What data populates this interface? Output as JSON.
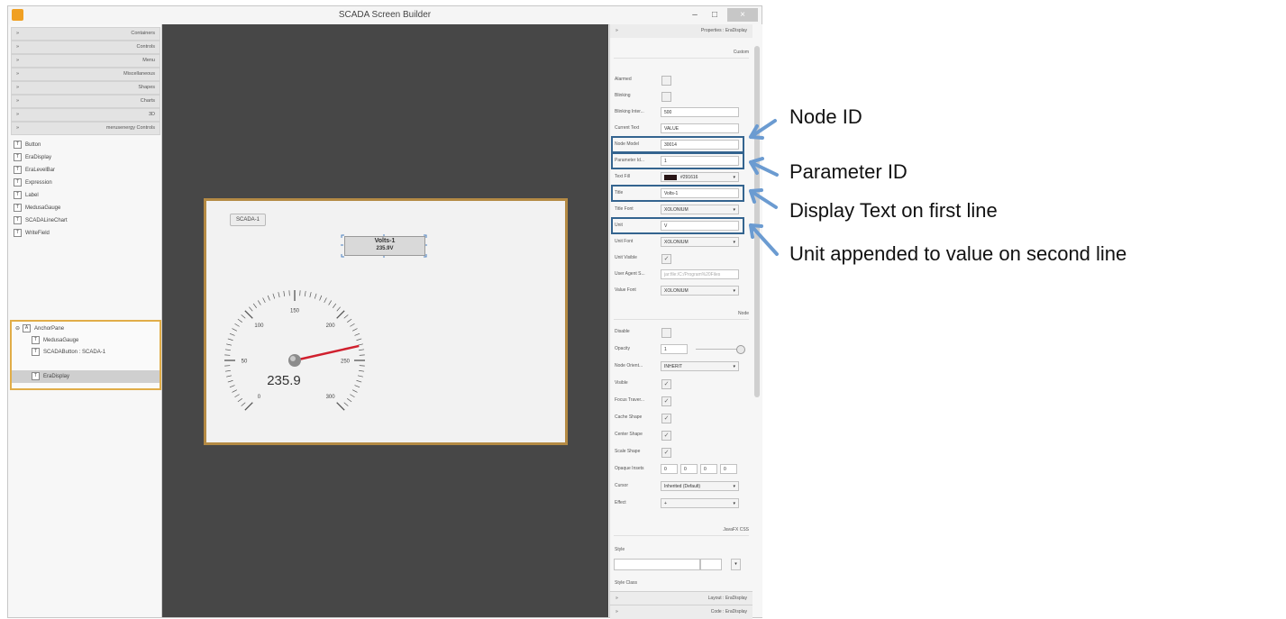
{
  "window": {
    "title": "SCADA Screen Builder",
    "controls": [
      "–",
      "□",
      "×"
    ]
  },
  "library": {
    "sections": [
      {
        "chevron": "»",
        "label": "Containers"
      },
      {
        "chevron": "»",
        "label": "Controls"
      },
      {
        "chevron": "»",
        "label": "Menu"
      },
      {
        "chevron": "»",
        "label": "Miscellaneous"
      },
      {
        "chevron": "»",
        "label": "Shapes"
      },
      {
        "chevron": "»",
        "label": "Charts"
      },
      {
        "chevron": "»",
        "label": "3D"
      },
      {
        "chevron": "»",
        "label": "merusenergy Controls"
      }
    ],
    "items": [
      "Button",
      "EraDisplay",
      "EraLevelBar",
      "Expression",
      "Label",
      "MedusaGauge",
      "SCADALineChart",
      "WriteField"
    ]
  },
  "hierarchy": {
    "root": "AnchorPane",
    "children": [
      "MedusaGauge",
      "SCADAButton : SCADA-1",
      "EraDisplay"
    ]
  },
  "canvas": {
    "button_label": "SCADA-1",
    "era_title": "Volts-1",
    "era_value": "235.9V",
    "gauge": {
      "value_text": "235.9",
      "value": 235.9,
      "min": 0,
      "max": 300,
      "tick_labels": [
        "0",
        "50",
        "100",
        "150",
        "200",
        "250",
        "300"
      ],
      "needle_color": "#d0202e"
    }
  },
  "properties": {
    "header": {
      "chevron": "»",
      "title": "Properties : EraDisplay"
    },
    "custom": {
      "heading": "Custom",
      "rows": [
        {
          "label": "Alarmed",
          "type": "check",
          "value": ""
        },
        {
          "label": "Blinking",
          "type": "check",
          "value": ""
        },
        {
          "label": "Blinking Inter...",
          "type": "input",
          "value": "500"
        },
        {
          "label": "Current Text",
          "type": "input",
          "value": "VALUE"
        },
        {
          "label": "Node Model",
          "type": "input",
          "value": "30014"
        },
        {
          "label": "Parameter Id...",
          "type": "input",
          "value": "1"
        },
        {
          "label": "Text Fill",
          "type": "combo",
          "value": "#291616"
        },
        {
          "label": "Title",
          "type": "input",
          "value": "Volts-1"
        },
        {
          "label": "Title Font",
          "type": "combo",
          "value": "XOLONIUM"
        },
        {
          "label": "Unit",
          "type": "input",
          "value": "V"
        },
        {
          "label": "Unit Font",
          "type": "combo",
          "value": "XOLONIUM"
        },
        {
          "label": "Unit Visible",
          "type": "check",
          "value": "✓"
        },
        {
          "label": "User Agent S...",
          "type": "input",
          "value": "jar:file:/C:/Program%20Files",
          "disabled": true
        },
        {
          "label": "Value Font",
          "type": "combo",
          "value": "XOLONIUM"
        }
      ]
    },
    "node": {
      "heading": "Node",
      "rows": [
        {
          "label": "Disable",
          "type": "check",
          "value": ""
        },
        {
          "label": "Opacity",
          "type": "input",
          "value": "1"
        },
        {
          "label": "Node Orient...",
          "type": "combo",
          "value": "INHERIT"
        },
        {
          "label": "Visible",
          "type": "check",
          "value": "✓"
        },
        {
          "label": "Focus Traver...",
          "type": "check",
          "value": "✓"
        },
        {
          "label": "Cache Shape",
          "type": "check",
          "value": "✓"
        },
        {
          "label": "Center Shape",
          "type": "check",
          "value": "✓"
        },
        {
          "label": "Scale Shape",
          "type": "check",
          "value": "✓"
        },
        {
          "label": "Opaque Insets",
          "type": "quad",
          "value": "0"
        },
        {
          "label": "Cursor",
          "type": "combo",
          "value": "Inherited (Default)"
        },
        {
          "label": "Effect",
          "type": "combo",
          "value": "+"
        }
      ]
    },
    "css": {
      "heading": "JavaFX CSS",
      "style_label": "Style",
      "style_class_label": "Style Class"
    },
    "footer": [
      {
        "chevron": "»",
        "title": "Layout : EraDisplay"
      },
      {
        "chevron": "»",
        "title": "Code : EraDisplay"
      }
    ]
  },
  "annotations": [
    "Node ID",
    "Parameter ID",
    "Display Text on first line",
    "Unit appended to value on second line"
  ],
  "colors": {
    "annotation_arrow": "#6b9bd1",
    "highlight_box": "#34648f",
    "selection_border": "#e1ad48"
  }
}
